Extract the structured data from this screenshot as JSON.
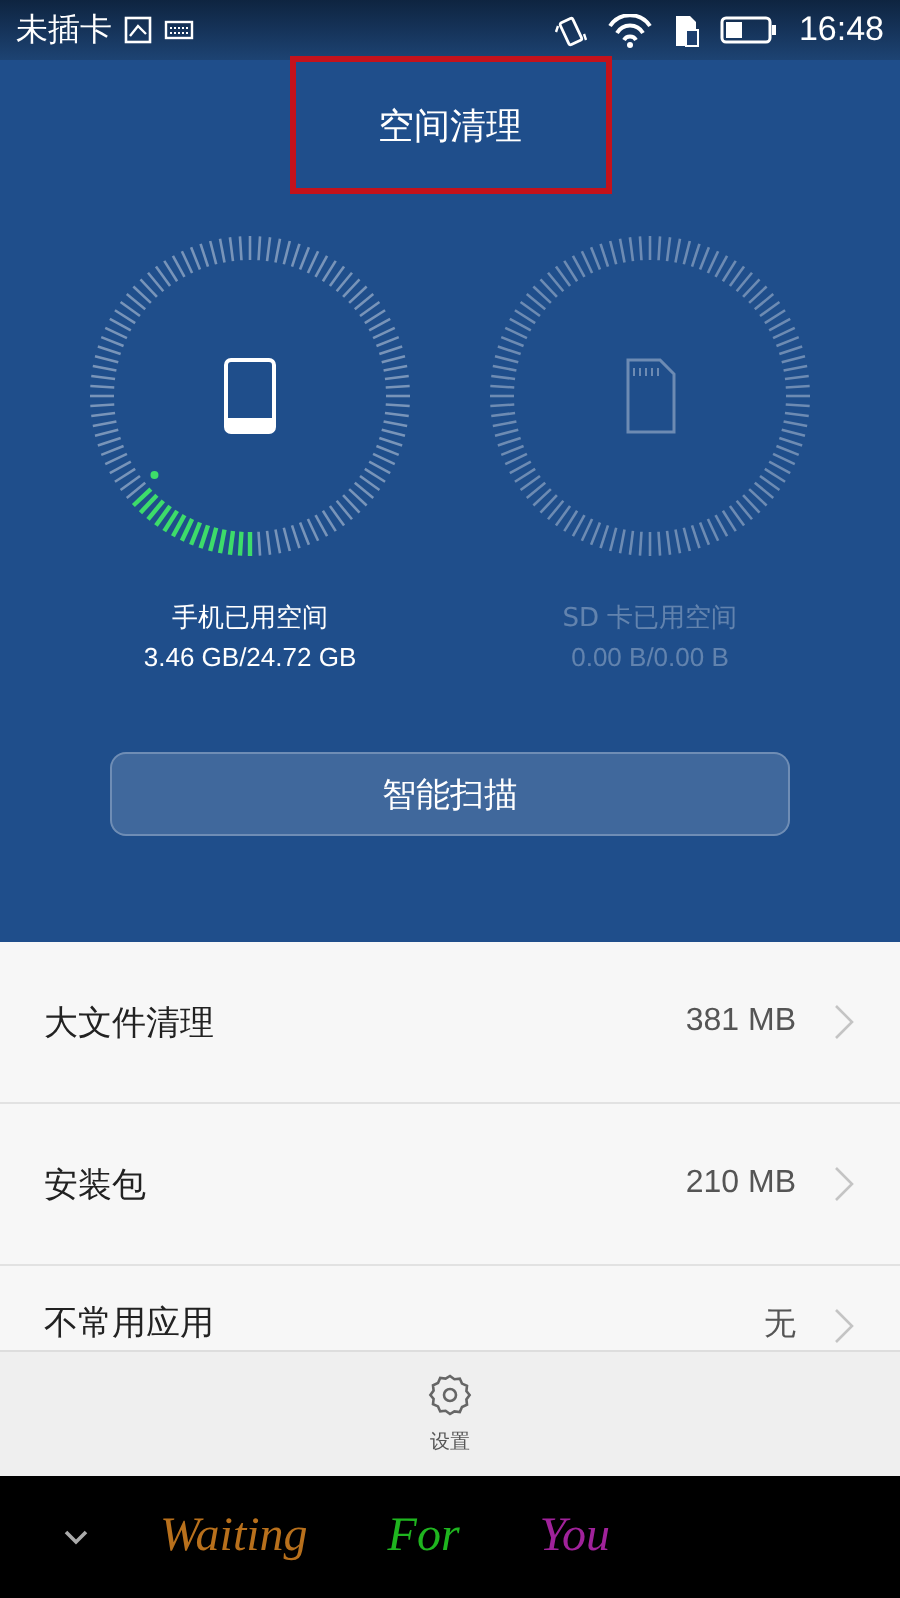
{
  "status_bar": {
    "carrier": "未插卡",
    "time": "16:48"
  },
  "title": {
    "text": "空间清理",
    "highlighted": true
  },
  "storage": [
    {
      "kind": "phone",
      "label": "手机已用空间",
      "usage": "3.46 GB/24.72 GB",
      "disabled": false
    },
    {
      "kind": "sdcard",
      "label": "SD 卡已用空间",
      "usage": "0.00 B/0.00 B",
      "disabled": true
    }
  ],
  "scan_button": "智能扫描",
  "items": [
    {
      "label": "大文件清理",
      "value": "381 MB"
    },
    {
      "label": "安装包",
      "value": "210 MB"
    },
    {
      "label": "不常用应用",
      "value": "无"
    }
  ],
  "footer": {
    "label": "设置"
  },
  "nav_bar": {
    "words": [
      {
        "text": "Waiting",
        "color": "#b8701c"
      },
      {
        "text": "For",
        "color": "#1fb51f"
      },
      {
        "text": "You",
        "color": "#a0229a"
      }
    ]
  }
}
